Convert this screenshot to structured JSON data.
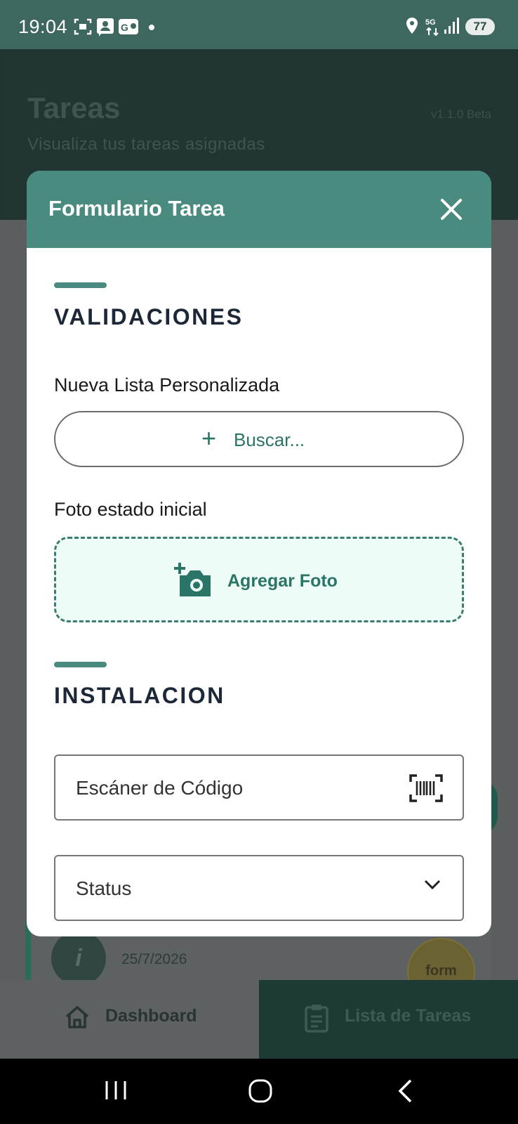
{
  "status_bar": {
    "time": "19:04",
    "battery": "77"
  },
  "app": {
    "title": "Tareas",
    "subtitle": "Visualiza tus tareas asignadas",
    "version": "v1.1.0 Beta"
  },
  "background": {
    "task_date": "25/7/2026",
    "task_badge": "form"
  },
  "bottom_nav": {
    "dashboard_label": "Dashboard",
    "tasks_label": "Lista de Tareas"
  },
  "modal": {
    "title": "Formulario Tarea",
    "section_validations": "VALIDACIONES",
    "list_label": "Nueva Lista Personalizada",
    "search_label": "Buscar...",
    "photo_label": "Foto estado inicial",
    "add_photo_label": "Agregar Foto",
    "section_installation": "INSTALACION",
    "scanner_placeholder": "Escáner de Código",
    "status_placeholder": "Status"
  },
  "colors": {
    "accent": "#4a8b80",
    "accent_text": "#2a7565",
    "photo_bg": "#edfcf6",
    "status_bar": "#3e675f"
  },
  "icons": [
    "screenshot-icon",
    "contact-icon",
    "g-pay-icon",
    "location-icon",
    "5g-icon",
    "signal-icon",
    "close-icon",
    "plus-icon",
    "add-photo-icon",
    "barcode-icon",
    "chevron-down-icon",
    "home-icon",
    "clipboard-icon",
    "recents-icon",
    "home-circle-icon",
    "back-icon"
  ]
}
